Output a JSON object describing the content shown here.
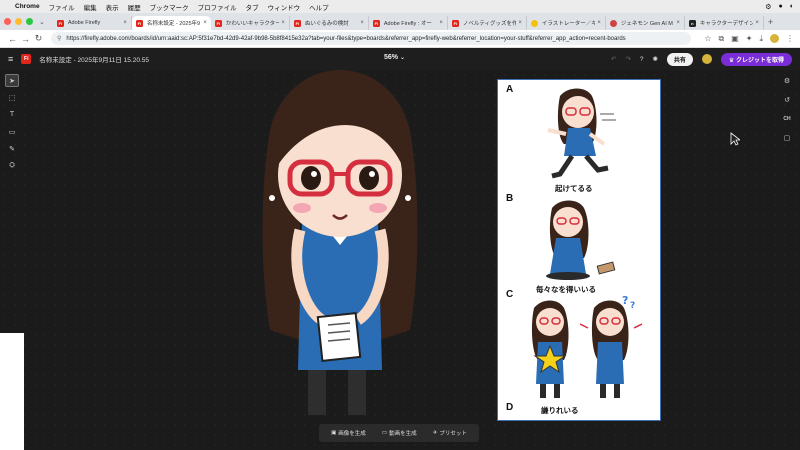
{
  "menubar": {
    "apple": "",
    "app": "Chrome",
    "items": [
      "ファイル",
      "編集",
      "表示",
      "履歴",
      "ブックマーク",
      "プロファイル",
      "タブ",
      "ウィンドウ",
      "ヘルプ"
    ]
  },
  "tabs": [
    {
      "title": "Adobe Firefly",
      "icon": "firefly-icon"
    },
    {
      "title": "名称未設定 - 2025年9",
      "icon": "firefly-icon",
      "active": true
    },
    {
      "title": "かわいいキャラクター",
      "icon": "firefly-icon"
    },
    {
      "title": "ぬいぐるみの検討",
      "icon": "firefly-icon"
    },
    {
      "title": "Adobe Firefly : オー",
      "icon": "firefly-icon"
    },
    {
      "title": "ノベルティグッズを作",
      "icon": "firefly-icon"
    },
    {
      "title": "イラストレーター／キ",
      "icon": "smile-icon"
    },
    {
      "title": "ジェネモン Gen AI M",
      "icon": "genemon-icon"
    },
    {
      "title": "キャラクターデザイン",
      "icon": "n-icon"
    }
  ],
  "address": {
    "url": "https://firefly.adobe.com/boards/id/urn:aaid:sc:AP:5f31e7bd-42d9-42af-9b98-5b8f8415e32a?tab=your-files&type=boards&referrer_app=firefly-web&referrer_location=your-stuff&referrer_app_action=recent-boards"
  },
  "app": {
    "logo": "Fi",
    "doc_title": "名称未設定 - 2025年9月11日 15.20.55",
    "zoom": "56%",
    "share": "共有",
    "credit": "クレジットを取得"
  },
  "artboard": {
    "labels": [
      "A",
      "B",
      "C",
      "D"
    ],
    "captions": [
      "起けてるる",
      "毎々なを得いいる",
      "謙りれいる"
    ]
  },
  "bottombar": {
    "image": "画像を生成",
    "video": "動画を生成",
    "preset": "プリセット"
  },
  "colors": {
    "accent": "#7a2dd6",
    "firefly_red": "#e1251b",
    "artboard_border": "#3f6fb5"
  }
}
